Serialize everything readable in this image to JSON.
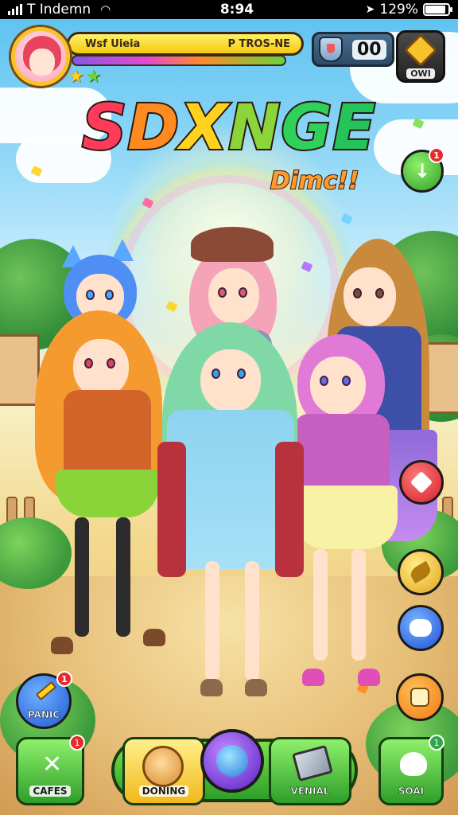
{
  "status_bar": {
    "carrier": "T Indemn",
    "time": "8:94",
    "battery": "129%"
  },
  "profile": {
    "name_left": "Wsf Uieia",
    "name_right": "P TROS-NE",
    "stars": [
      "★",
      "★"
    ]
  },
  "currency": {
    "value": "00"
  },
  "shop_button": {
    "label": "OWI"
  },
  "title": {
    "letters": [
      "S",
      "D",
      "X",
      "N",
      "G",
      "E"
    ],
    "subtitle": "Dimc!!"
  },
  "side_buttons": {
    "top_badge": "1",
    "nav_left_badge": "1",
    "games_badge": "1",
    "soali_badge": "1"
  },
  "bottom_nav": {
    "nav_left_label": "PANIC",
    "games_label": "CAFES",
    "doning_label": "DONING",
    "venial_label": "VENIAL",
    "soali_label": "SOAI"
  },
  "colors": {
    "accent_yellow": "#f7c22c",
    "accent_green": "#2e9e2a",
    "accent_red": "#e62b2b",
    "accent_purple": "#7a3fd6"
  }
}
